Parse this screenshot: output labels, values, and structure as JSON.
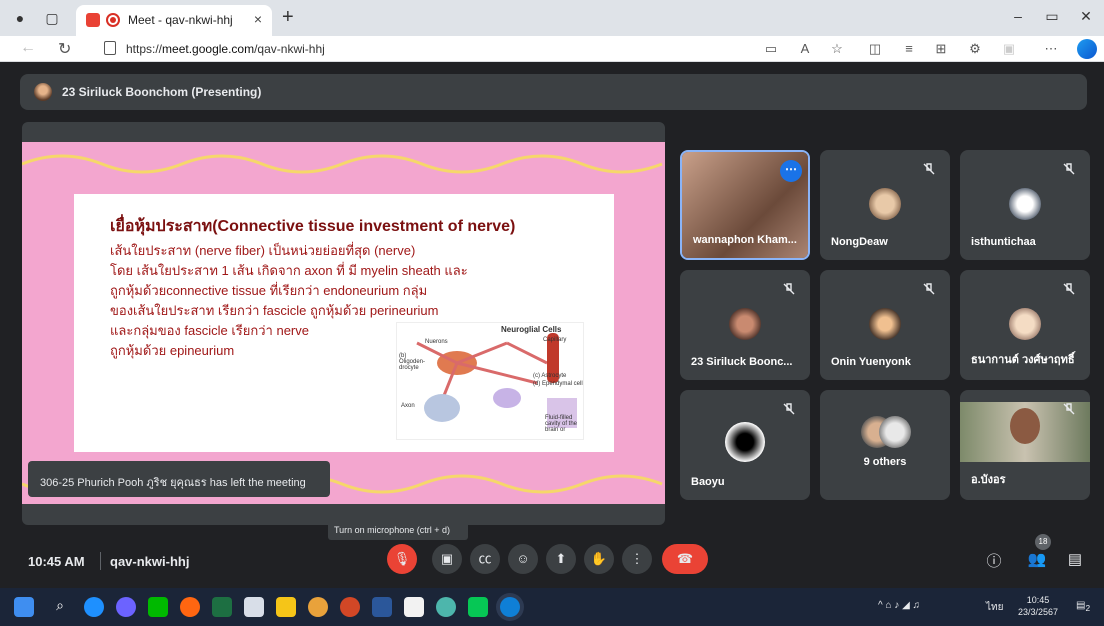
{
  "browser": {
    "tab_title": "Meet - qav-nkwi-hhj",
    "tab_close": "×",
    "new_tab": "+",
    "url_prefix": "https://",
    "url_host": "meet.google.com",
    "url_path": "/qav-nkwi-hhj"
  },
  "meet": {
    "presenter_label": "23 Siriluck Boonchom (Presenting)",
    "toast": "306-25 Phurich Pooh ภูริช ยุคุณธร has left the meeting",
    "tooltip": "Turn on microphone (ctrl + d)",
    "time": "10:45 AM",
    "meeting_code": "qav-nkwi-hhj",
    "participants_count": "18"
  },
  "slide": {
    "title": "เยื่อหุ้มประสาท(Connective tissue investment of nerve)",
    "lines": [
      "เส้นใยประสาท (nerve fiber) เป็นหน่วยย่อยที่สุด (nerve)",
      "โดย เส้นใยประสาท 1 เส้น เกิดจาก axon ที่ มี myelin sheath และ",
      "ถูกหุ้มด้วยconnective tissue ที่เรียกว่า endoneurium กลุ่ม",
      "ของเส้นใยประสาท เรียกว่า fascicle ถูกหุ้มด้วย perineurium",
      "และกลุ่มของ fascicle เรียกว่า nerve",
      "ถูกหุ้มด้วย epineurium"
    ],
    "diagram": {
      "title": "Neuroglial Cells",
      "labels": [
        "Nuerons",
        "Capillary",
        "(b) Oligoden-drocyte",
        "(c) Astrocyte",
        "(d) Ependymal cell",
        "Axon",
        "Fluid-filled cavity of the brain or"
      ]
    }
  },
  "tiles": [
    {
      "name": "wannaphon Kham...",
      "active": true
    },
    {
      "name": "NongDeaw"
    },
    {
      "name": "isthuntichaa"
    },
    {
      "name": "23 Siriluck Boonc..."
    },
    {
      "name": "Onin Yuenyonk"
    },
    {
      "name": "ธนากานต์ วงศ์ษาฤทธิ์"
    },
    {
      "name": "Baoyu"
    },
    {
      "name": "9 others"
    },
    {
      "name": "อ.บังอร"
    }
  ],
  "taskbar": {
    "tray_lang": "ไทย",
    "time": "10:45",
    "date": "23/3/2567",
    "notif": "2"
  },
  "colors": {
    "hangup": "#ea4335",
    "accent": "#1a73e8",
    "slide_bg": "#f3a6cf"
  }
}
